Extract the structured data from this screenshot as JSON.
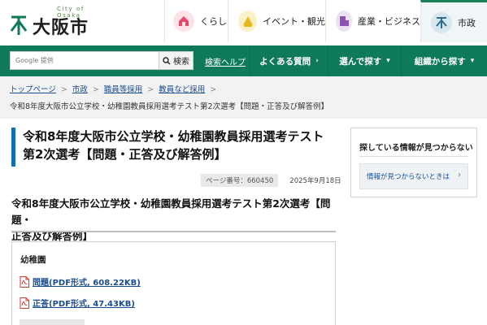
{
  "header": {
    "logo_small": "City of Osaka",
    "logo_text": "大阪市",
    "nav": [
      {
        "label": "くらし",
        "icon": "house-icon",
        "color": "#e24b6d"
      },
      {
        "label": "イベント・観光",
        "icon": "tourism-icon",
        "color": "#e6b91e"
      },
      {
        "label": "産業・ビジネス",
        "icon": "building-icon",
        "color": "#8a55b0"
      },
      {
        "label": "市政",
        "icon": "city-mark-icon",
        "color": "#2b6e8f"
      }
    ]
  },
  "search": {
    "placeholder": "Google 提供",
    "button_label": "検索",
    "help_label": "検索ヘルプ"
  },
  "green_nav": [
    {
      "label": "よくある質問",
      "chevron": "›"
    },
    {
      "label": "選んで探す",
      "chevron": "▾"
    },
    {
      "label": "組織から探す",
      "chevron": "▾"
    }
  ],
  "breadcrumb": {
    "links": [
      "トップページ",
      "市政",
      "職員等採用",
      "教員など採用"
    ],
    "separator": ">",
    "current": "令和8年度大阪市公立学校・幼稚園教員採用選考テスト第2次選考【問題・正答及び解答例】"
  },
  "main": {
    "title_line1": "令和8年度大阪市公立学校・幼稚園教員採用選考テスト",
    "title_line2": "第2次選考【問題・正答及び解答例】",
    "page_number": "ページ番号：660450",
    "date": "2025年9月18日",
    "h2_line1": "令和8年度大阪市公立学校・幼稚園教員採用選考テスト第2次選考【問題・",
    "h2_line2": "正答及び解答例】",
    "section_title": "幼稚園",
    "files": [
      {
        "label": "問題(PDF形式, 608.22KB)",
        "icon": "pdf-icon"
      },
      {
        "label": "正答(PDF形式, 47.43KB)",
        "icon": "pdf-icon"
      }
    ]
  },
  "sidebar": {
    "heading": "探している情報が見つからない",
    "button_label": "情報が見つからないときは",
    "chevron": "›"
  },
  "colors": {
    "brand_green": "#0f7a5b",
    "title_accent": "#0f6fb3",
    "link": "#1a4d8f",
    "pdf_red": "#d9342b"
  }
}
